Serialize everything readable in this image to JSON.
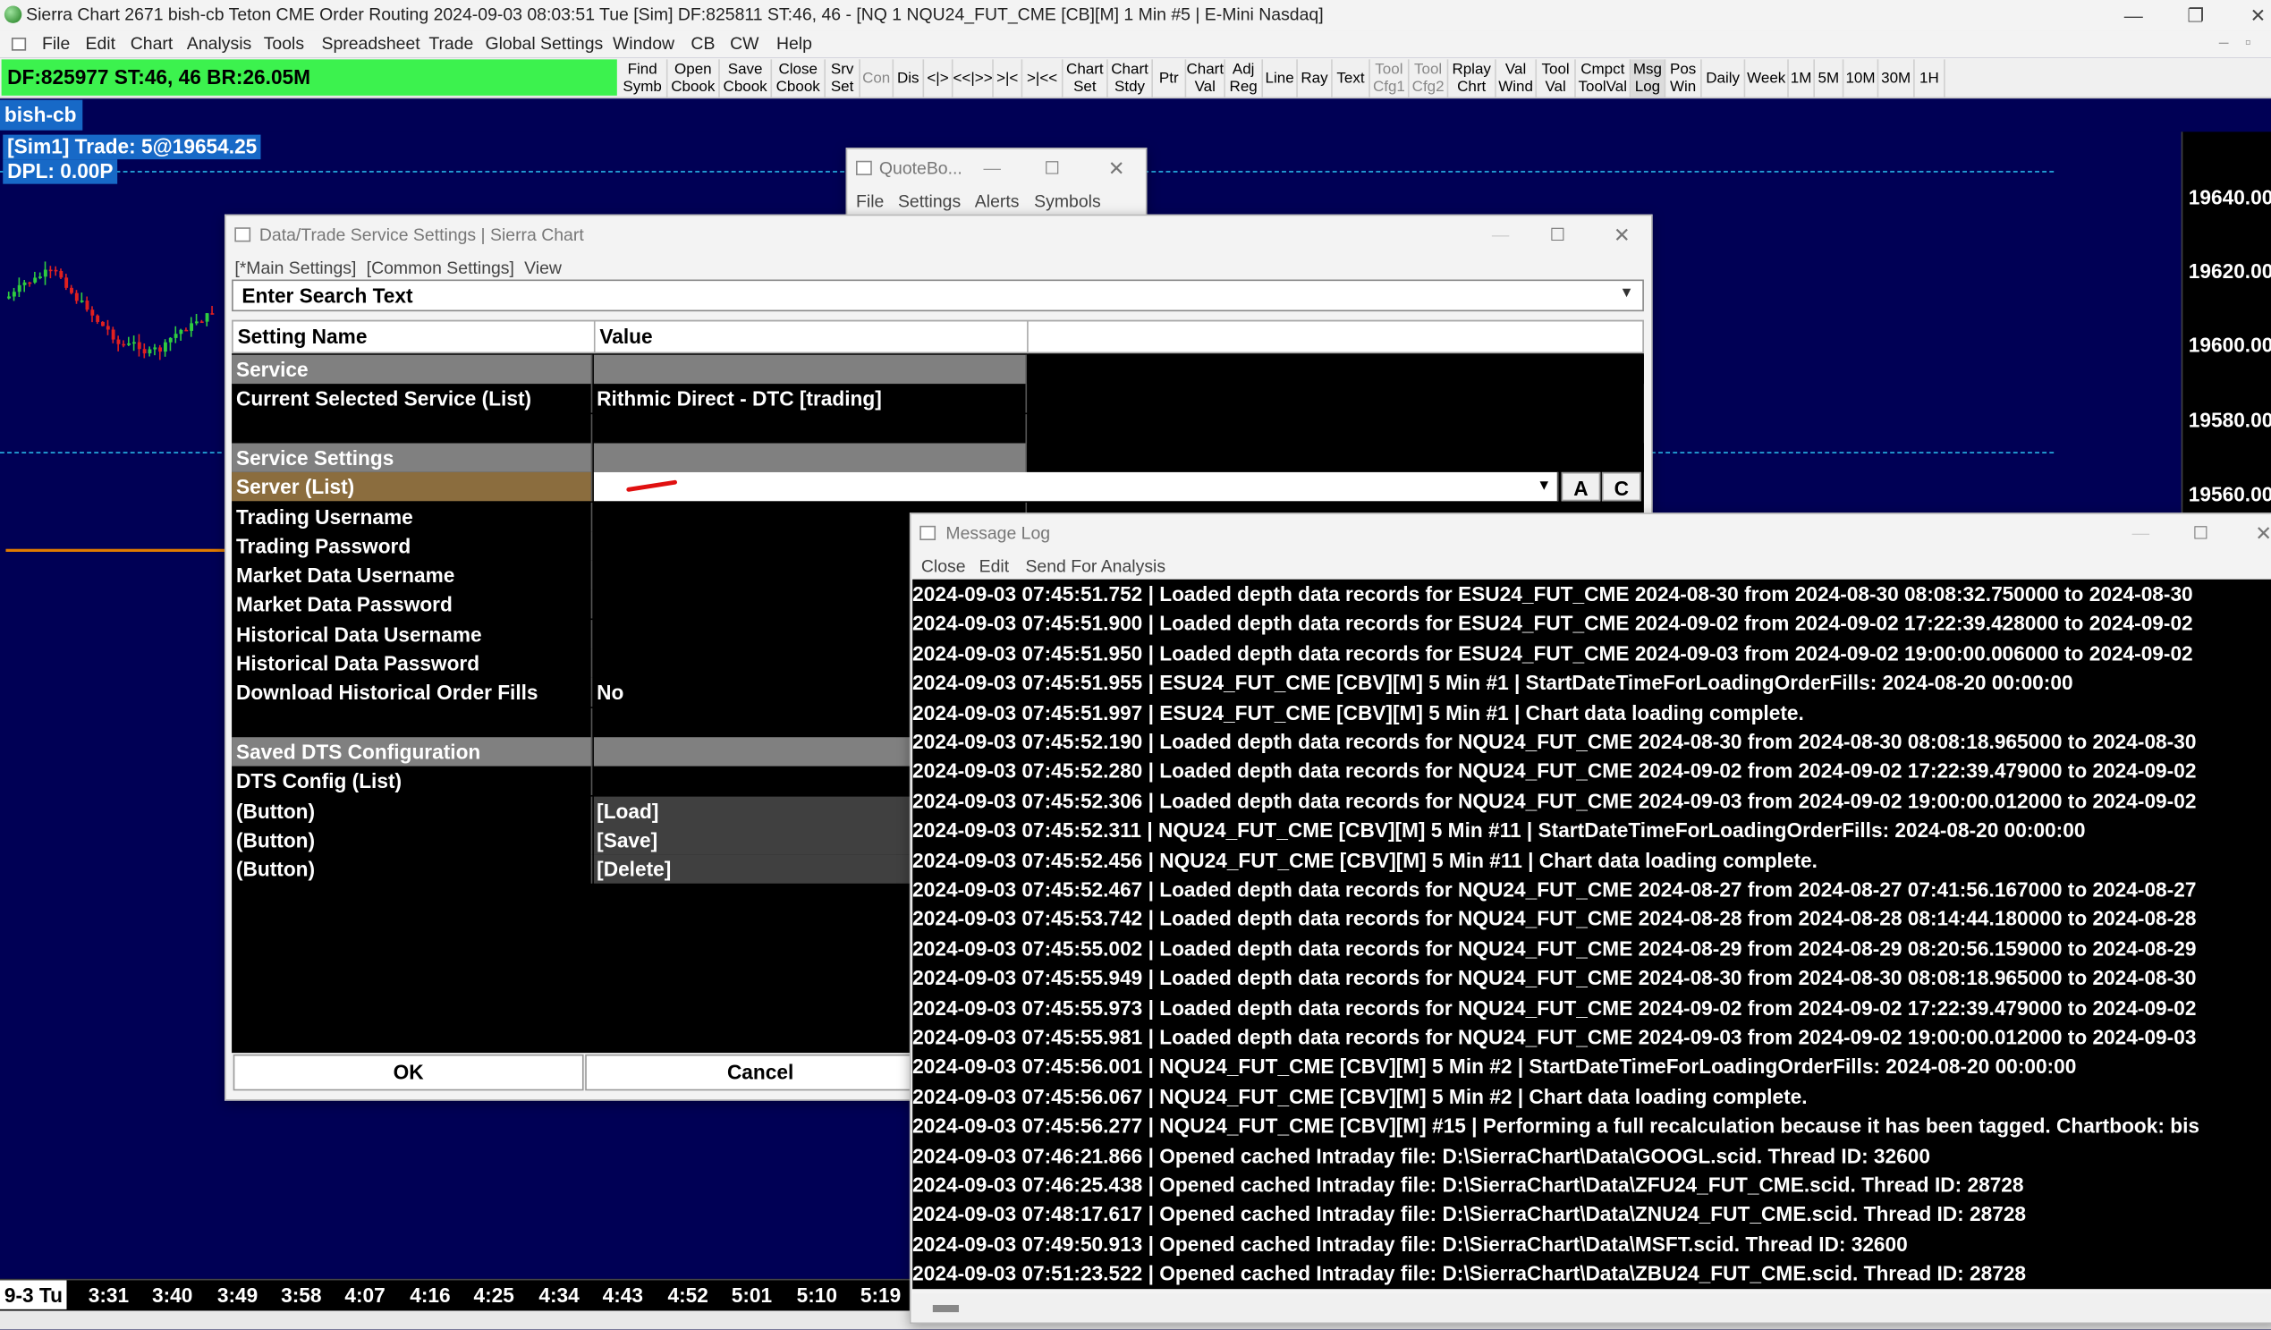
{
  "window": {
    "title": "Sierra Chart 2671 bish-cb Teton CME Order Routing 2024-09-03  08:03:51 Tue [Sim] DF:825811  ST:46, 46 - [NQ 1 NQU24_FUT_CME [CB][M]  1 Min  #5 | E-Mini Nasdaq]",
    "minimize": "—",
    "maximize": "❐",
    "close": "✕"
  },
  "menu": [
    "File",
    "Edit",
    "Chart",
    "Analysis",
    "Tools",
    "Spreadsheet",
    "Trade",
    "Global Settings",
    "Window",
    "CB",
    "CW",
    "Help"
  ],
  "status": {
    "text": "DF:825977  ST:46, 46  BR:26.05M"
  },
  "toolbar": [
    {
      "label": "Find\nSymb"
    },
    {
      "label": "Open\nCbook"
    },
    {
      "label": "Save\nCbook"
    },
    {
      "label": "Close\nCbook"
    },
    {
      "label": "Srv\nSet"
    },
    {
      "label": "Con",
      "disabled": true
    },
    {
      "label": "Dis"
    },
    {
      "label": "<|>"
    },
    {
      "label": "<<|>>"
    },
    {
      "label": ">|<"
    },
    {
      "label": ">|<<"
    },
    {
      "label": "Chart\nSet"
    },
    {
      "label": "Chart\nStdy"
    },
    {
      "label": "Ptr"
    },
    {
      "label": "Chart\nVal"
    },
    {
      "label": "Adj\nReg"
    },
    {
      "label": "Line"
    },
    {
      "label": "Ray"
    },
    {
      "label": "Text"
    },
    {
      "label": "Tool\nCfg1",
      "disabled": true
    },
    {
      "label": "Tool\nCfg2",
      "disabled": true
    },
    {
      "label": "Rplay\nChrt"
    },
    {
      "label": "Val\nWind"
    },
    {
      "label": "Tool\nVal"
    },
    {
      "label": "Cmpct\nToolVal"
    },
    {
      "label": "Msg\nLog"
    },
    {
      "label": "Pos\nWin"
    },
    {
      "label": "Daily"
    },
    {
      "label": "Week"
    },
    {
      "label": "1M"
    },
    {
      "label": "5M"
    },
    {
      "label": "10M"
    },
    {
      "label": "30M"
    },
    {
      "label": "1H"
    }
  ],
  "chart": {
    "tab": "bish-cb",
    "trade_line1": "[Sim1]  Trade: 5@19654.25",
    "trade_line2": "DPL: 0.00P",
    "prices": [
      "19640.00",
      "19620.00",
      "19600.00",
      "19580.00",
      "19560.00"
    ],
    "times": [
      "9-3 Tu",
      "3:31",
      "3:40",
      "3:49",
      "3:58",
      "4:07",
      "4:16",
      "4:25",
      "4:34",
      "4:43",
      "4:52",
      "5:01",
      "5:10",
      "5:19"
    ],
    "colors": {
      "background": "#000055",
      "up": "#2ecc40",
      "down": "#e02020",
      "dashed": "#27b4e6",
      "orange": "#e07b00"
    }
  },
  "quoteboard": {
    "title": "QuoteBo...",
    "menu": [
      "File",
      "Settings",
      "Alerts",
      "Symbols"
    ]
  },
  "dts": {
    "title": "Data/Trade Service Settings | Sierra Chart",
    "menu": [
      "[*Main Settings]",
      "[Common Settings]",
      "View"
    ],
    "search_placeholder": "Enter Search Text",
    "header": {
      "name": "Setting Name",
      "value": "Value"
    },
    "rows": [
      {
        "name": "Service",
        "value": "",
        "type": "section"
      },
      {
        "name": "Current Selected Service (List)",
        "value": "Rithmic Direct - DTC    [trading]"
      },
      {
        "name": "",
        "value": ""
      },
      {
        "name": "Service Settings",
        "value": "",
        "type": "section"
      },
      {
        "name": "Server (List)",
        "value": "",
        "type": "server"
      },
      {
        "name": "Trading Username",
        "value": ""
      },
      {
        "name": "Trading Password",
        "value": ""
      },
      {
        "name": "Market Data Username",
        "value": ""
      },
      {
        "name": "Market Data Password",
        "value": ""
      },
      {
        "name": "Historical Data Username",
        "value": ""
      },
      {
        "name": "Historical Data Password",
        "value": ""
      },
      {
        "name": "Download Historical Order Fills",
        "value": "No"
      },
      {
        "name": "",
        "value": ""
      },
      {
        "name": "Saved DTS Configuration",
        "value": "",
        "type": "section"
      },
      {
        "name": "DTS Config (List)",
        "value": ""
      },
      {
        "name": " (Button)",
        "value": "[Load]",
        "type": "button"
      },
      {
        "name": " (Button)",
        "value": "[Save]",
        "type": "button"
      },
      {
        "name": " (Button)",
        "value": "[Delete]",
        "type": "button"
      }
    ],
    "btn_a": "A",
    "btn_c": "C",
    "ok": "OK",
    "cancel": "Cancel"
  },
  "msglog": {
    "title": "Message Log",
    "menu": [
      "Close",
      "Edit",
      "Send For Analysis"
    ],
    "lines": [
      "2024-09-03  07:45:51.752 | Loaded depth data records for ESU24_FUT_CME 2024-08-30 from 2024-08-30  08:08:32.750000 to 2024-08-30",
      "2024-09-03  07:45:51.900 | Loaded depth data records for ESU24_FUT_CME 2024-09-02 from 2024-09-02  17:22:39.428000 to 2024-09-02",
      "2024-09-03  07:45:51.950 | Loaded depth data records for ESU24_FUT_CME 2024-09-03 from 2024-09-02  19:00:00.006000 to 2024-09-02",
      "2024-09-03  07:45:51.955 | ESU24_FUT_CME [CBV][M]  5 Min  #1 | StartDateTimeForLoadingOrderFills: 2024-08-20  00:00:00",
      "2024-09-03  07:45:51.997 | ESU24_FUT_CME [CBV][M]  5 Min  #1 | Chart data loading complete.",
      "2024-09-03  07:45:52.190 | Loaded depth data records for NQU24_FUT_CME 2024-08-30 from 2024-08-30  08:08:18.965000 to 2024-08-30",
      "2024-09-03  07:45:52.280 | Loaded depth data records for NQU24_FUT_CME 2024-09-02 from 2024-09-02  17:22:39.479000 to 2024-09-02",
      "2024-09-03  07:45:52.306 | Loaded depth data records for NQU24_FUT_CME 2024-09-03 from 2024-09-02  19:00:00.012000 to 2024-09-02",
      "2024-09-03  07:45:52.311 | NQU24_FUT_CME [CBV][M]  5 Min  #11 | StartDateTimeForLoadingOrderFills: 2024-08-20  00:00:00",
      "2024-09-03  07:45:52.456 | NQU24_FUT_CME [CBV][M]  5 Min  #11 | Chart data loading complete.",
      "2024-09-03  07:45:52.467 | Loaded depth data records for NQU24_FUT_CME 2024-08-27 from 2024-08-27  07:41:56.167000 to 2024-08-27",
      "2024-09-03  07:45:53.742 | Loaded depth data records for NQU24_FUT_CME 2024-08-28 from 2024-08-28  08:14:44.180000 to 2024-08-28",
      "2024-09-03  07:45:55.002 | Loaded depth data records for NQU24_FUT_CME 2024-08-29 from 2024-08-29  08:20:56.159000 to 2024-08-29",
      "2024-09-03  07:45:55.949 | Loaded depth data records for NQU24_FUT_CME 2024-08-30 from 2024-08-30  08:08:18.965000 to 2024-08-30",
      "2024-09-03  07:45:55.973 | Loaded depth data records for NQU24_FUT_CME 2024-09-02 from 2024-09-02  17:22:39.479000 to 2024-09-02",
      "2024-09-03  07:45:55.981 | Loaded depth data records for NQU24_FUT_CME 2024-09-03 from 2024-09-02  19:00:00.012000 to 2024-09-03",
      "2024-09-03  07:45:56.001 | NQU24_FUT_CME [CBV][M]  5 Min  #2 | StartDateTimeForLoadingOrderFills: 2024-08-20  00:00:00",
      "2024-09-03  07:45:56.067 | NQU24_FUT_CME [CBV][M]  5 Min  #2 | Chart data loading complete.",
      "2024-09-03  07:45:56.277 | NQU24_FUT_CME [CBV][M] #15 | Performing a full recalculation because it has been tagged. Chartbook: bis",
      "2024-09-03  07:46:21.866 | Opened cached Intraday file: D:\\SierraChart\\Data\\GOOGL.scid. Thread ID: 32600",
      "2024-09-03  07:46:25.438 | Opened cached Intraday file: D:\\SierraChart\\Data\\ZFU24_FUT_CME.scid. Thread ID: 28728",
      "2024-09-03  07:48:17.617 | Opened cached Intraday file: D:\\SierraChart\\Data\\ZNU24_FUT_CME.scid. Thread ID: 28728",
      "2024-09-03  07:49:50.913 | Opened cached Intraday file: D:\\SierraChart\\Data\\MSFT.scid. Thread ID: 32600",
      "2024-09-03  07:51:23.522 | Opened cached Intraday file: D:\\SierraChart\\Data\\ZBU24_FUT_CME.scid. Thread ID: 28728"
    ]
  }
}
